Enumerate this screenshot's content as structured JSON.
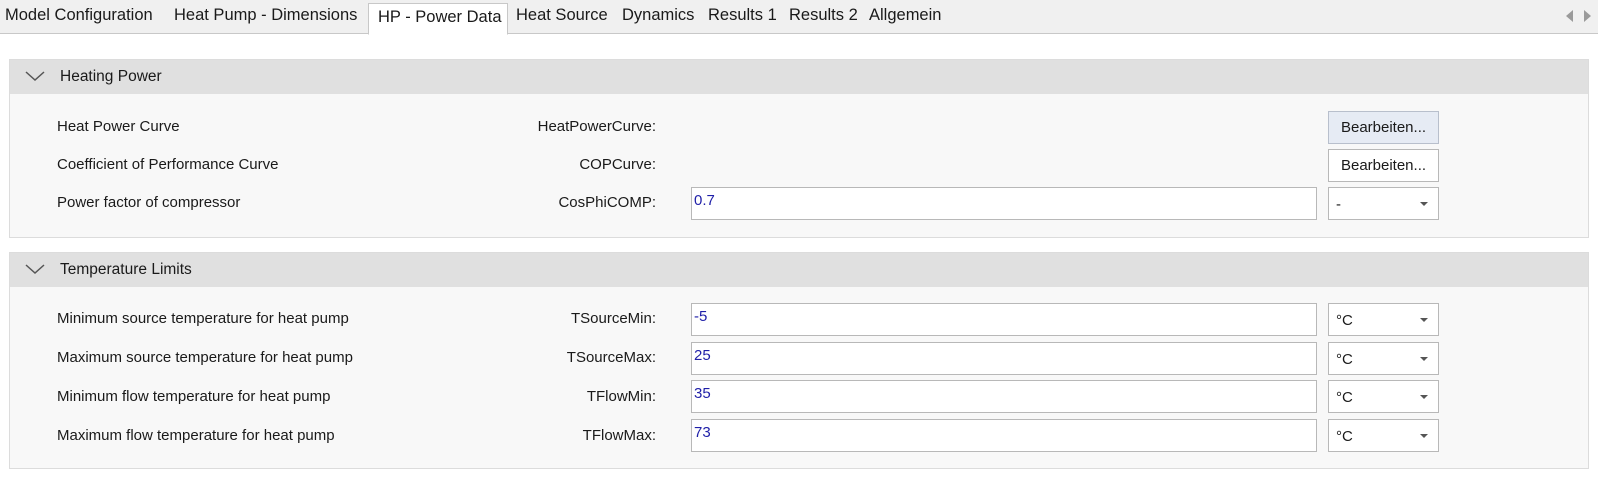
{
  "tabs": [
    {
      "label": "Model Configuration"
    },
    {
      "label": "Heat Pump - Dimensions"
    },
    {
      "label": "HP - Power Data"
    },
    {
      "label": "Heat Source"
    },
    {
      "label": "Dynamics"
    },
    {
      "label": "Results 1"
    },
    {
      "label": "Results 2"
    },
    {
      "label": "Allgemein"
    }
  ],
  "active_tab": "HP - Power Data",
  "icons": {
    "tab_scroll_left": "triangle-left-icon",
    "tab_scroll_right": "triangle-right-icon",
    "group_toggle": "chevron-down-icon",
    "dropdown": "dropdown-arrow-icon"
  },
  "heating_power": {
    "title": "Heating Power",
    "rows": [
      {
        "description": "Heat Power Curve",
        "parameter": "HeatPowerCurve:",
        "button_label": "Bearbeiten..."
      },
      {
        "description": "Coefficient of Performance Curve",
        "parameter": "COPCurve:",
        "button_label": "Bearbeiten..."
      },
      {
        "description": "Power factor of compressor",
        "parameter": "CosPhiCOMP:",
        "value": "0.7",
        "unit": "-"
      }
    ]
  },
  "temperature_limits": {
    "title": "Temperature Limits",
    "rows": [
      {
        "description": "Minimum source temperature for heat pump",
        "parameter": "TSourceMin:",
        "value": "-5",
        "unit": "°C"
      },
      {
        "description": "Maximum source temperature for heat pump",
        "parameter": "TSourceMax:",
        "value": "25",
        "unit": "°C"
      },
      {
        "description": "Minimum flow temperature for heat pump",
        "parameter": "TFlowMin:",
        "value": "35",
        "unit": "°C"
      },
      {
        "description": "Maximum flow temperature for heat pump",
        "parameter": "TFlowMax:",
        "value": "73",
        "unit": "°C"
      }
    ]
  },
  "colors": {
    "value_text": "#1f1fa8",
    "group_header_bg": "#e0e0e0",
    "hover_button_bg": "#e6ebf4"
  }
}
